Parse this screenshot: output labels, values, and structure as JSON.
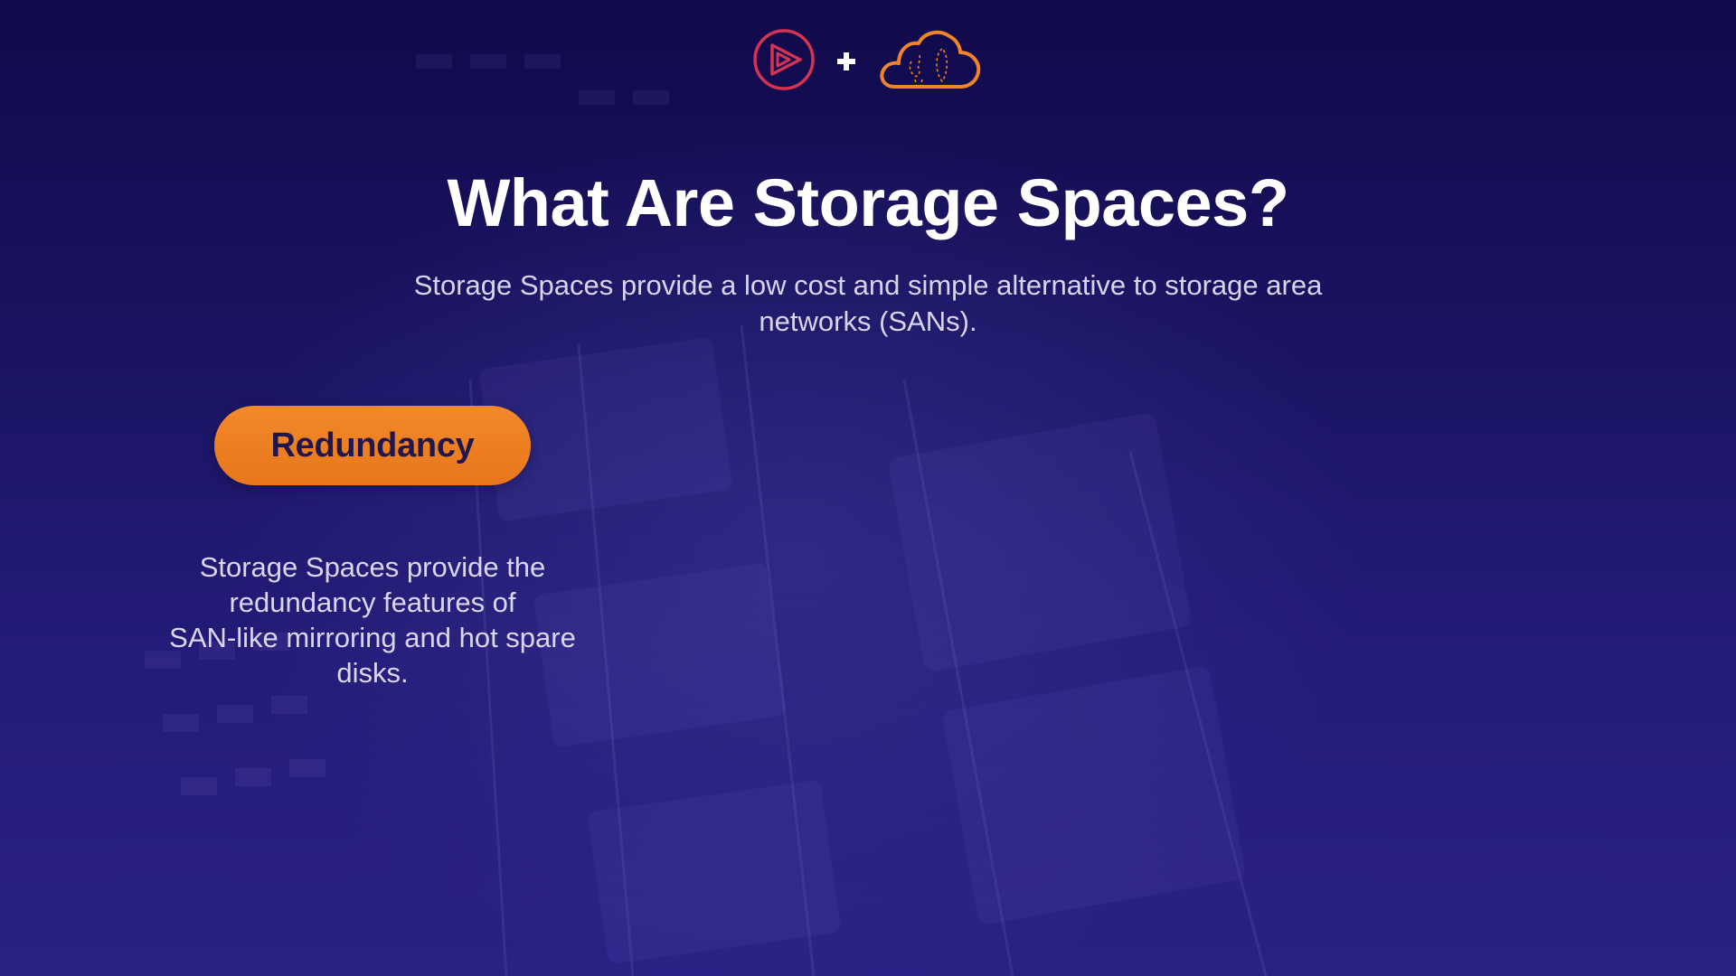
{
  "slide": {
    "title": "What Are Storage Spaces?",
    "subtitle": "Storage Spaces provide a low cost and simple alternative to storage area networks (SANs).",
    "feature": {
      "label": "Redundancy",
      "description_lines": [
        "Storage Spaces provide the",
        "redundancy features of",
        "SAN-like mirroring and hot spare",
        "disks."
      ]
    }
  },
  "logos": {
    "left": "play-logo",
    "separator": "plus-icon",
    "right": "cloud-logo"
  },
  "colors": {
    "background": "#1a1460",
    "accent_orange": "#f0842a",
    "play_logo_red": "#d63251",
    "title_text": "#ffffff",
    "pill_text": "#21174f"
  }
}
